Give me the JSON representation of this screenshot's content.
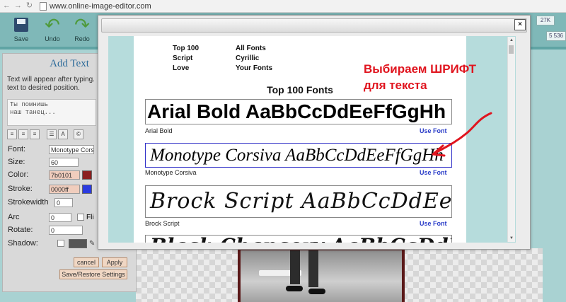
{
  "browser": {
    "url": "www.online-image-editor.com"
  },
  "toolbar": {
    "save_label": "Save",
    "undo_label": "Undo",
    "redo_label": "Redo",
    "badge_1": "27K",
    "badge_2": "5 536"
  },
  "left_panel": {
    "title": "Add Text",
    "info_line1": "Text will appear after typing.",
    "info_line2": "text to desired position.",
    "textarea_value": "Ты помнишь\nнаш танец...",
    "font_label": "Font:",
    "font_value": "Monotype Corsiva",
    "size_label": "Size:",
    "size_value": "60",
    "color_label": "Color:",
    "color_value": "7b0101",
    "color_swatch": "#8b1e1e",
    "stroke_label": "Stroke:",
    "stroke_value": "0000ff",
    "stroke_swatch": "#2b3be0",
    "strokewidth_label": "Strokewidth",
    "strokewidth_value": "0",
    "arc_label": "Arc",
    "arc_value": "0",
    "flip_label": "Fli",
    "rotate_label": "Rotate:",
    "rotate_value": "0",
    "shadow_label": "Shadow:",
    "cancel_label": "cancel",
    "apply_label": "Apply",
    "save_restore_label": "Save/Restore Settings"
  },
  "font_dialog": {
    "close_label": "×",
    "categories": {
      "top100": "Top 100",
      "script": "Script",
      "love": "Love",
      "all_fonts": "All Fonts",
      "cyrillic": "Cyrillic",
      "your_fonts": "Your Fonts"
    },
    "heading": "Top 100 Fonts",
    "use_font_label": "Use Font",
    "fonts": [
      {
        "name": "Arial Bold",
        "sample": "Arial Bold  AaBbCcDdEeFfGgHh"
      },
      {
        "name": "Monotype Corsiva",
        "sample": "Monotype Corsiva  AaBbCcDdEeFfGgHh"
      },
      {
        "name": "Brock Script",
        "sample": "Brock Script  AaBbCcDdEeFf"
      },
      {
        "name": "Black Chancery",
        "sample": "Black Chancery  AaBbCcDdEeFf"
      }
    ]
  },
  "annotation": {
    "line1": "Выбираем ШРИФТ",
    "line2": "для текста",
    "color": "#e0141e"
  }
}
